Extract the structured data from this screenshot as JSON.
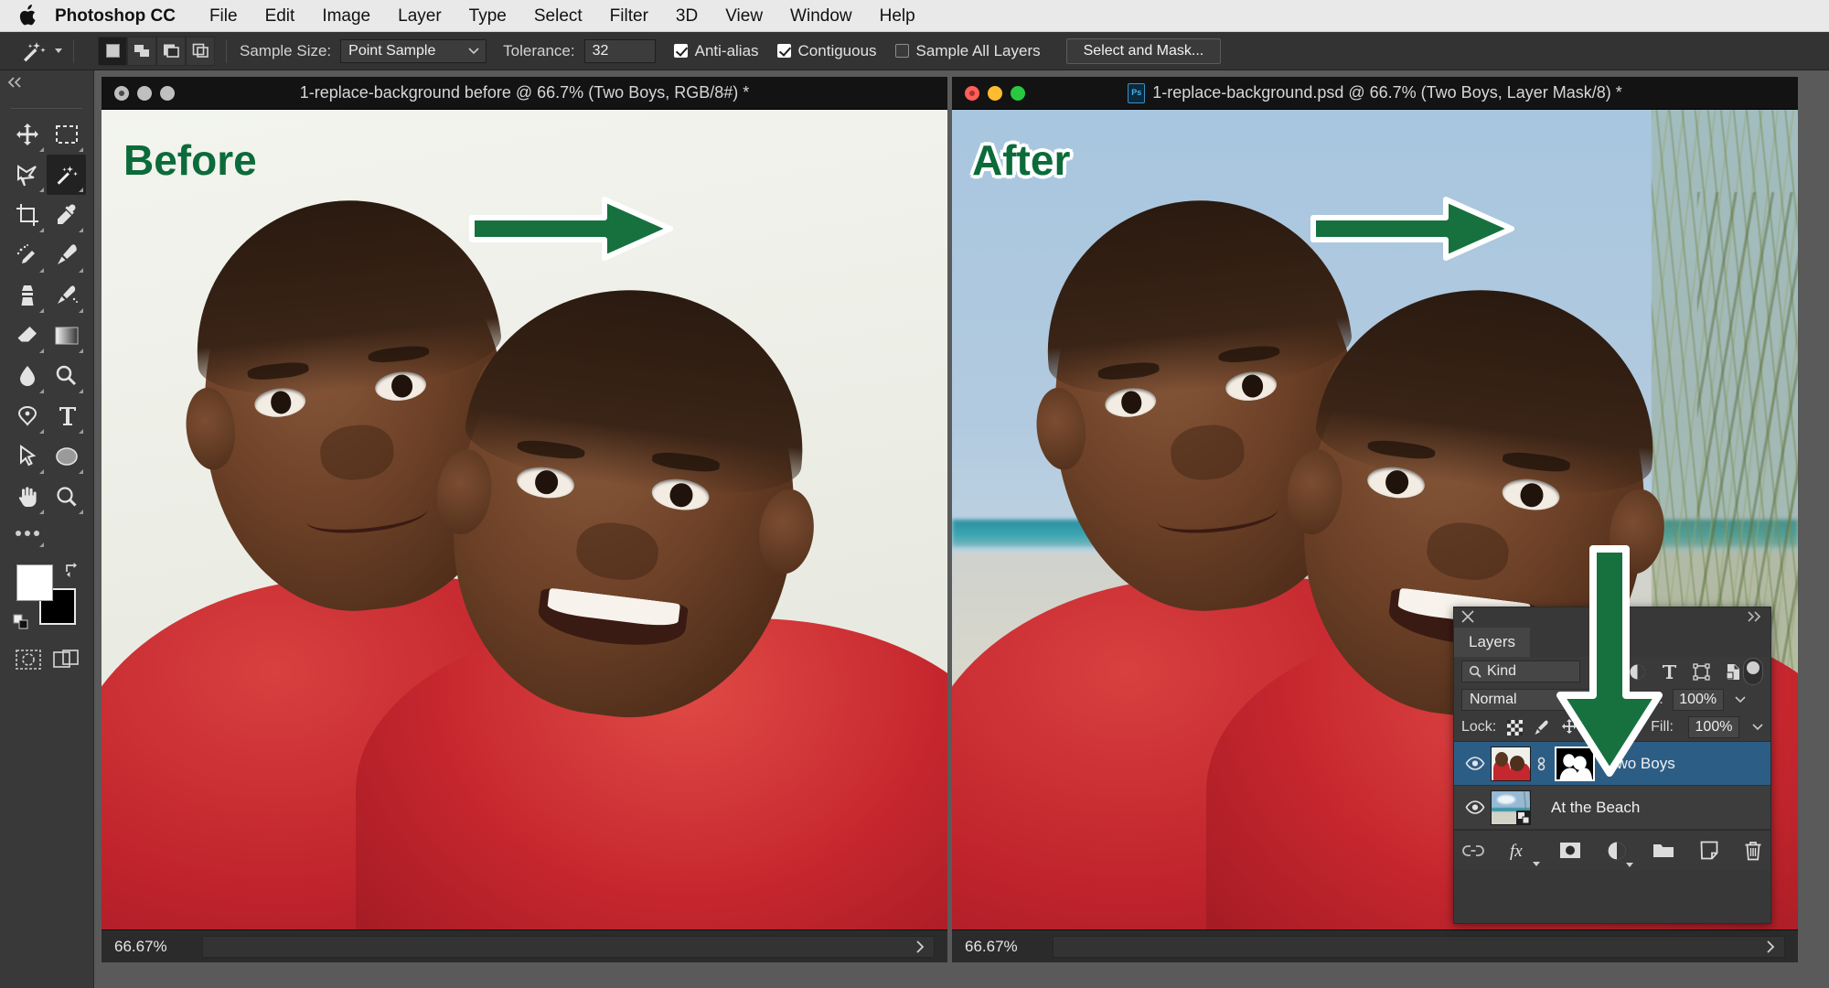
{
  "menubar": {
    "apple_icon": "apple-logo",
    "app_title": "Photoshop CC",
    "items": [
      "File",
      "Edit",
      "Image",
      "Layer",
      "Type",
      "Select",
      "Filter",
      "3D",
      "View",
      "Window",
      "Help"
    ]
  },
  "options_bar": {
    "tool_icon": "magic-wand-icon",
    "selection_modes": [
      "new-selection",
      "add-to-selection",
      "subtract-from-selection",
      "intersect-with-selection"
    ],
    "active_selection_mode": 0,
    "sample_size_label": "Sample Size:",
    "sample_size_value": "Point Sample",
    "tolerance_label": "Tolerance:",
    "tolerance_value": "32",
    "anti_alias_label": "Anti-alias",
    "anti_alias_checked": true,
    "contiguous_label": "Contiguous",
    "contiguous_checked": true,
    "sample_all_layers_label": "Sample All Layers",
    "sample_all_layers_checked": false,
    "select_and_mask_label": "Select and Mask..."
  },
  "tools": {
    "collapse_icon": "double-chevron-left-icon",
    "items": [
      "move-tool",
      "rectangular-marquee-tool",
      "lasso-tool",
      "magic-wand-tool",
      "crop-tool",
      "eyedropper-tool",
      "healing-brush-tool",
      "brush-tool",
      "clone-stamp-tool",
      "history-brush-tool",
      "eraser-tool",
      "gradient-tool",
      "blur-tool",
      "dodge-tool",
      "pen-tool",
      "type-tool",
      "path-selection-tool",
      "ellipse-tool",
      "hand-tool",
      "zoom-tool"
    ],
    "selected_tool": "magic-wand-tool",
    "more_tools_icon": "ellipsis-icon",
    "foreground_color": "#ffffff",
    "background_color": "#000000",
    "swap_colors_icon": "swap-colors-icon",
    "default_colors_icon": "default-colors-icon",
    "quick_mask_icon": "quick-mask-icon",
    "screen_mode_icon": "screen-mode-icon"
  },
  "documents": [
    {
      "id": "before",
      "title": "1-replace-background before @ 66.7% (Two Boys, RGB/8#) *",
      "has_ps_icon": false,
      "traffic_lights": "inactive",
      "overlay_label": "Before",
      "overlay_label_style": "plain",
      "zoom": "66.67%",
      "background_type": "white-studio"
    },
    {
      "id": "after",
      "title": "1-replace-background.psd @ 66.7% (Two Boys, Layer Mask/8) *",
      "has_ps_icon": true,
      "ps_icon_text": "Ps",
      "traffic_lights": "active",
      "overlay_label": "After",
      "overlay_label_style": "outlined",
      "zoom": "66.67%",
      "background_type": "beach"
    }
  ],
  "annotations": {
    "arrow_color": "#0b6b3a",
    "arrow_outline": "#ffffff",
    "arrows": [
      "right-arrow-before",
      "right-arrow-after",
      "down-arrow-layers"
    ]
  },
  "layers_panel": {
    "close_icon": "close-icon",
    "collapse_icon": "double-chevron-right-icon",
    "tab_label": "Layers",
    "menu_icon": "panel-menu-icon",
    "filter_label": "Kind",
    "filter_search_icon": "search-icon",
    "filter_icons": [
      "pixel-layer-filter-icon",
      "adjustment-layer-filter-icon",
      "type-layer-filter-icon",
      "shape-layer-filter-icon",
      "smart-object-filter-icon"
    ],
    "filter_toggle": "filter-enable-toggle",
    "blend_mode": "Normal",
    "opacity_label": "Opacity:",
    "opacity_value": "100%",
    "lock_label": "Lock:",
    "lock_icons": [
      "lock-transparent-pixels-icon",
      "lock-image-pixels-icon",
      "lock-position-icon",
      "lock-artboard-nesting-icon",
      "lock-all-icon"
    ],
    "fill_label": "Fill:",
    "fill_value": "100%",
    "rows": [
      {
        "name": "Two Boys",
        "visible": true,
        "selected": true,
        "has_link_icon": true,
        "has_mask": true,
        "mask_selected": true,
        "thumb_type": "boys-photo",
        "badge": null
      },
      {
        "name": "At the Beach",
        "visible": true,
        "selected": false,
        "has_link_icon": false,
        "has_mask": false,
        "mask_selected": false,
        "thumb_type": "beach-photo",
        "badge": "smart-object-badge"
      }
    ],
    "footer_icons": [
      "link-layers-icon",
      "layer-style-fx-icon",
      "add-layer-mask-icon",
      "new-adjustment-layer-icon",
      "new-group-icon",
      "new-layer-icon",
      "delete-layer-icon"
    ],
    "footer_fx_label": "fx"
  },
  "colors": {
    "menubar_bg": "#e9e9e9",
    "panel_bg": "#383838",
    "options_bg": "#333333",
    "selected_layer_bg": "#2c5d85",
    "accent_green": "#0b6b3a",
    "shirt_red": "#c4272e"
  }
}
